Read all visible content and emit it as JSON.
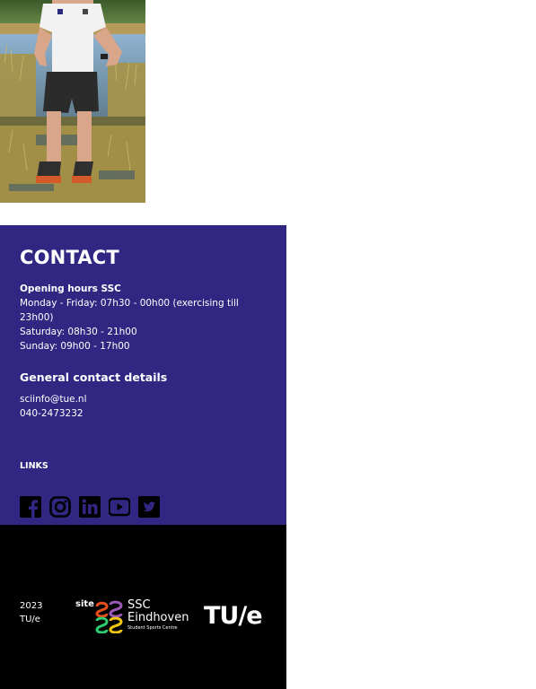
{
  "contact": {
    "title": "CONTACT",
    "hours_label": "Opening hours SSC",
    "hours": [
      "Monday - Friday: 07h30 - 00h00 (exercising till 23h00)",
      "Saturday: 08h30 - 21h00",
      "Sunday: 09h00 - 17h00"
    ],
    "details_title": "General contact details",
    "email": "sciinfo@tue.nl",
    "phone": "040-2473232",
    "links_title": "LINKS"
  },
  "social": [
    "facebook-icon",
    "instagram-icon",
    "linkedin-icon",
    "youtube-icon",
    "twitter-icon"
  ],
  "footer": {
    "year": "2023",
    "org": "TU/e",
    "site": "site",
    "ssc_name_line1": "SSC",
    "ssc_name_line2": "Eindhoven",
    "ssc_subtitle": "Student Sports Centre",
    "tue_logo": "TU/e"
  },
  "colors": {
    "contact_bg": "#312783",
    "footer_bg": "#000000"
  }
}
